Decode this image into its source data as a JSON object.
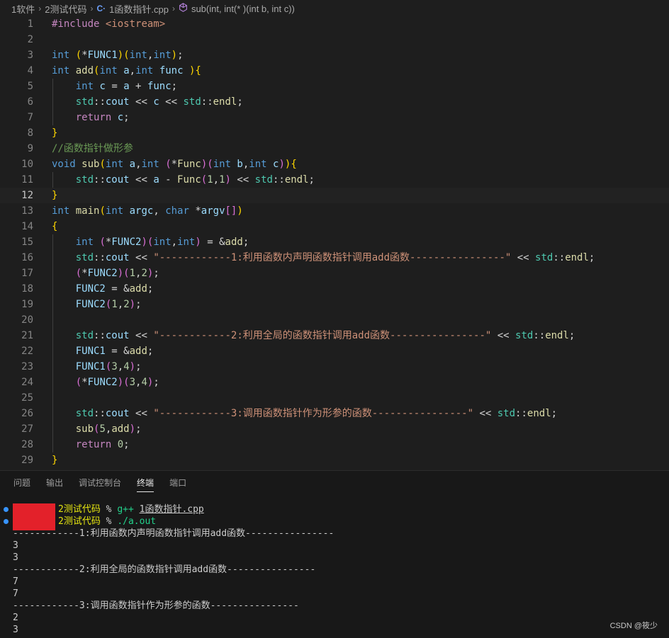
{
  "breadcrumb": {
    "items": [
      "1软件",
      "2测试代码",
      "1函数指针.cpp",
      "sub(int, int(* )(int b, int c))"
    ],
    "separator": "›",
    "cpp_icon": "C·",
    "icons": {
      "file": "cpp-file-icon",
      "symbol": "method-cube-icon"
    }
  },
  "editor": {
    "active_line": 12,
    "line_numbers": [
      "1",
      "2",
      "3",
      "4",
      "5",
      "6",
      "7",
      "8",
      "9",
      "10",
      "11",
      "12",
      "13",
      "14",
      "15",
      "16",
      "17",
      "18",
      "19",
      "20",
      "21",
      "22",
      "23",
      "24",
      "25",
      "26",
      "27",
      "28",
      "29"
    ],
    "tokens": {
      "include": "#include",
      "iostream": "<iostream>",
      "int": "int",
      "void": "void",
      "char": "char",
      "return": "return",
      "FUNC1": "FUNC1",
      "FUNC2": "FUNC2",
      "add": "add",
      "sub": "sub",
      "main": "main",
      "Func": "Func",
      "func": "func",
      "a": "a",
      "b": "b",
      "c": "c",
      "argc": "argc",
      "argv": "argv",
      "std": "std",
      "cout": "cout",
      "endl": "endl",
      "comment9": "//函数指针做形参",
      "str16": "\"------------1:利用函数内声明函数指针调用add函数----------------\"",
      "str21": "\"------------2:利用全局的函数指针调用add函数----------------\"",
      "str26": "\"------------3:调用函数指针作为形参的函数----------------\"",
      "n0": "0",
      "n1": "1",
      "n2": "2",
      "n3": "3",
      "n4": "4",
      "n5": "5"
    }
  },
  "panel": {
    "tabs": [
      "问题",
      "输出",
      "调试控制台",
      "终端",
      "端口"
    ],
    "active_tab": "终端"
  },
  "terminal": {
    "lines": [
      {
        "dir": "2测试代码",
        "prompt": "%",
        "cmd": "g++",
        "arg": "1函数指针.cpp"
      },
      {
        "dir": "2测试代码",
        "prompt": "%",
        "cmd": "./a.out"
      }
    ],
    "output": [
      "------------1:利用函数内声明函数指针调用add函数----------------",
      "3",
      "3",
      "------------2:利用全局的函数指针调用add函数----------------",
      "7",
      "7",
      "------------3:调用函数指针作为形参的函数----------------",
      "2",
      "3"
    ]
  },
  "watermark": "CSDN @筱少",
  "colors": {
    "accent": "#3794ff",
    "redacted": "#e3212a"
  }
}
